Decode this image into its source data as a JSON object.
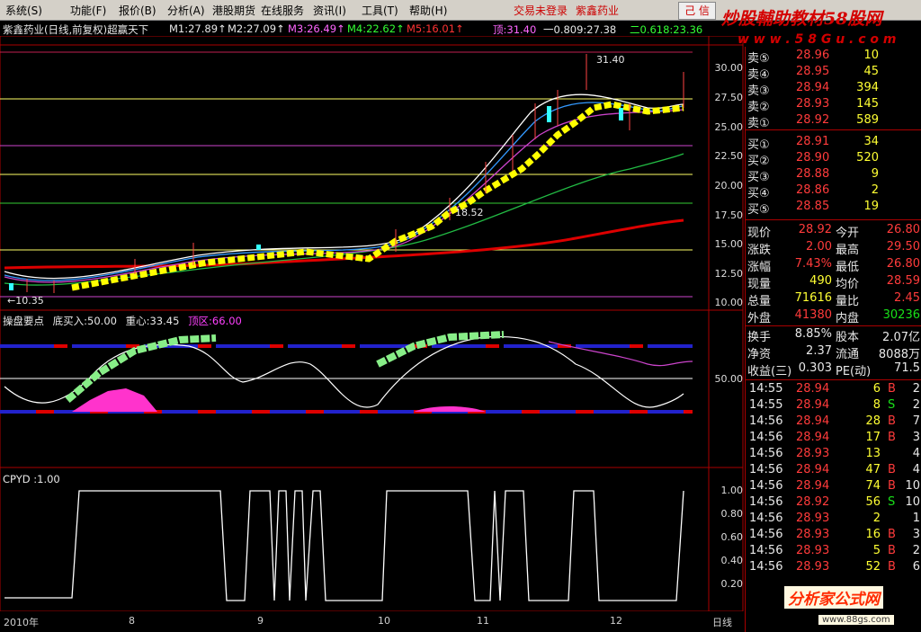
{
  "menu": {
    "items": [
      "系统(S)",
      "功能(F)",
      "报价(B)",
      "分析(A)",
      "港股期货",
      "在线服务",
      "资讯(I)",
      "工具(T)",
      "帮助(H)"
    ],
    "notice": "交易未登录",
    "stock_name": "紫鑫药业",
    "close_label": "己 信"
  },
  "watermark": {
    "top": "炒股輔助教材58股网",
    "url": "w w w . 5 8 G u . c o m",
    "bottom": "分析家公式网",
    "bottom_url": "www.88gs.com"
  },
  "main_chart": {
    "title": "紫鑫药业(日线,前复权)超赢天下",
    "marks": "××",
    "m1": "M1:27.89↑",
    "m2": "M2:27.09↑",
    "m3": "M3:26.49↑",
    "m4": "M4:22.62↑",
    "m5": "M5:16.01↑",
    "fib1": "顶:31.40",
    "fib2": "一0.809:27.38",
    "fib3": "二0.618:23.36",
    "high_label": "31.40",
    "low_label": "←10.35",
    "mid_label": "18.52",
    "y_ticks": [
      "30.00",
      "27.50",
      "25.00",
      "22.50",
      "20.00",
      "17.50",
      "15.00",
      "12.50",
      "10.00"
    ]
  },
  "indicator": {
    "title": "操盘要点",
    "p1": "底买入:50.00",
    "p2": "重心:33.45",
    "p3": "顶区:66.00",
    "y_tick": "50.00"
  },
  "cpyd": {
    "title": "CPYD :1.00",
    "y_ticks": [
      "1.00",
      "0.80",
      "0.60",
      "0.40",
      "0.20"
    ]
  },
  "x_dates": [
    "2010年",
    "8",
    "9",
    "10",
    "11",
    "12"
  ],
  "x_unit": "日线",
  "order_book": {
    "asks": [
      {
        "label": "卖⑤",
        "price": "28.96",
        "vol": "10"
      },
      {
        "label": "卖④",
        "price": "28.95",
        "vol": "45"
      },
      {
        "label": "卖③",
        "price": "28.94",
        "vol": "394"
      },
      {
        "label": "卖②",
        "price": "28.93",
        "vol": "145"
      },
      {
        "label": "卖①",
        "price": "28.92",
        "vol": "589"
      }
    ],
    "bids": [
      {
        "label": "买①",
        "price": "28.91",
        "vol": "34"
      },
      {
        "label": "买②",
        "price": "28.90",
        "vol": "520"
      },
      {
        "label": "买③",
        "price": "28.88",
        "vol": "9"
      },
      {
        "label": "买④",
        "price": "28.86",
        "vol": "2"
      },
      {
        "label": "买⑤",
        "price": "28.85",
        "vol": "19"
      }
    ]
  },
  "stats": [
    {
      "k1": "现价",
      "v1": "28.92",
      "k2": "今开",
      "v2": "26.80"
    },
    {
      "k1": "涨跌",
      "v1": "2.00",
      "k2": "最高",
      "v2": "29.50"
    },
    {
      "k1": "涨幅",
      "v1": "7.43%",
      "k2": "最低",
      "v2": "26.80"
    },
    {
      "k1": "现量",
      "v1": "490",
      "k2": "均价",
      "v2": "28.59"
    },
    {
      "k1": "总量",
      "v1": "71616",
      "k2": "量比",
      "v2": "2.45"
    },
    {
      "k1": "外盘",
      "v1": "41380",
      "k2": "内盘",
      "v2": "30236"
    }
  ],
  "fund": [
    {
      "k1": "换手",
      "v1": "8.85%",
      "k2": "股本",
      "v2": "2.07亿"
    },
    {
      "k1": "净资",
      "v1": "2.37",
      "k2": "流通",
      "v2": "8088万"
    },
    {
      "k1": "收益(三)",
      "v1": "0.303",
      "k2": "PE(动)",
      "v2": "71.5"
    }
  ],
  "ticks": [
    {
      "t": "14:55",
      "p": "28.94",
      "v": "6",
      "d": "B",
      "n": "2"
    },
    {
      "t": "14:55",
      "p": "28.94",
      "v": "8",
      "d": "S",
      "n": "2"
    },
    {
      "t": "14:56",
      "p": "28.94",
      "v": "28",
      "d": "B",
      "n": "7"
    },
    {
      "t": "14:56",
      "p": "28.94",
      "v": "17",
      "d": "B",
      "n": "3"
    },
    {
      "t": "14:56",
      "p": "28.93",
      "v": "13",
      "d": "",
      "n": "4"
    },
    {
      "t": "14:56",
      "p": "28.94",
      "v": "47",
      "d": "B",
      "n": "4"
    },
    {
      "t": "14:56",
      "p": "28.94",
      "v": "74",
      "d": "B",
      "n": "10"
    },
    {
      "t": "14:56",
      "p": "28.92",
      "v": "56",
      "d": "S",
      "n": "10"
    },
    {
      "t": "14:56",
      "p": "28.93",
      "v": "2",
      "d": "",
      "n": "1"
    },
    {
      "t": "14:56",
      "p": "28.93",
      "v": "16",
      "d": "B",
      "n": "3"
    },
    {
      "t": "14:56",
      "p": "28.93",
      "v": "5",
      "d": "B",
      "n": "2"
    },
    {
      "t": "14:56",
      "p": "28.93",
      "v": "52",
      "d": "B",
      "n": "6"
    }
  ]
}
